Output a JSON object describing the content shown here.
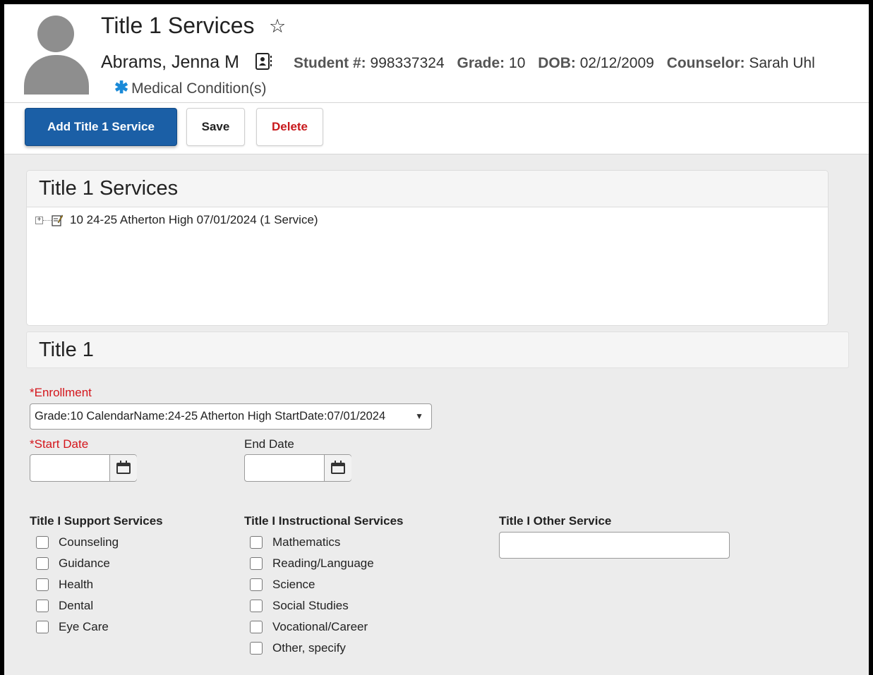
{
  "header": {
    "page_title": "Title 1 Services",
    "student_name": "Abrams, Jenna M",
    "student_number_label": "Student #:",
    "student_number": "998337324",
    "grade_label": "Grade:",
    "grade": "10",
    "dob_label": "DOB:",
    "dob": "02/12/2009",
    "counselor_label": "Counselor:",
    "counselor": "Sarah Uhl",
    "medical_label": "Medical Condition(s)"
  },
  "toolbar": {
    "add_label": "Add Title 1 Service",
    "save_label": "Save",
    "delete_label": "Delete"
  },
  "services_panel": {
    "heading": "Title 1 Services",
    "tree_item": "10 24-25 Atherton High 07/01/2024 (1 Service)"
  },
  "title1": {
    "heading": "Title 1",
    "enrollment_label": "Enrollment",
    "enrollment_value": "Grade:10 CalendarName:24-25 Atherton High StartDate:07/01/2024",
    "start_date_label": "Start Date",
    "end_date_label": "End Date",
    "start_date_value": "",
    "end_date_value": ""
  },
  "support_services": {
    "heading": "Title I Support Services",
    "items": [
      "Counseling",
      "Guidance",
      "Health",
      "Dental",
      "Eye Care"
    ]
  },
  "instructional_services": {
    "heading": "Title I Instructional Services",
    "items": [
      "Mathematics",
      "Reading/Language",
      "Science",
      "Social Studies",
      "Vocational/Career",
      "Other, specify"
    ]
  },
  "other_service": {
    "heading": "Title I Other Service",
    "value": ""
  },
  "colors": {
    "primary_button": "#1b5fa6",
    "delete_text": "#c8191c",
    "required_text": "#d4161c",
    "medical_icon": "#1a8ad8"
  },
  "icons": {
    "favorite": "star-icon",
    "contact": "contact-card-icon",
    "medical": "asterisk-icon",
    "tree_expand": "plus-box-icon",
    "tree_item": "notepad-icon",
    "calendar": "calendar-icon",
    "dropdown": "caret-down-icon"
  }
}
